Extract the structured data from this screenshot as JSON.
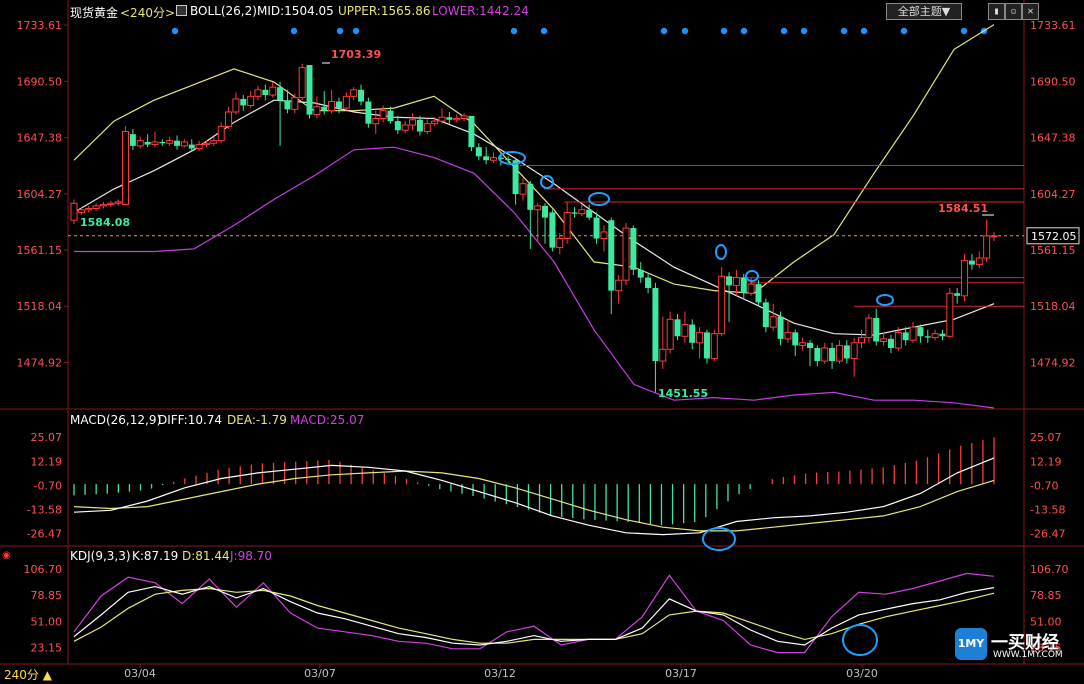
{
  "header": {
    "title": "现货黄金",
    "period": "<240分>",
    "boll_label": "BOLL(26,2)",
    "mid": "MID:1504.05",
    "upper": "UPPER:1565.86",
    "lower": "LOWER:1442.24",
    "theme_button": "全部主题▼"
  },
  "window_buttons": [
    "▮",
    "▫",
    "✕"
  ],
  "price_axis": {
    "ticks": [
      "1733.61",
      "1690.50",
      "1647.38",
      "1604.27",
      "1561.15",
      "1518.04",
      "1474.92"
    ],
    "current_price": "1572.05"
  },
  "annotations": {
    "high": "1703.39",
    "low": "1451.55",
    "left_price": "1584.08",
    "right_high": "1584.51"
  },
  "macd_panel": {
    "label": "MACD(26,12,9)",
    "diff": "DIFF:10.74",
    "dea": "DEA:-1.79",
    "macd": "MACD:25.07",
    "ticks": [
      "25.07",
      "12.19",
      "-0.70",
      "-13.58",
      "-26.47"
    ]
  },
  "kdj_panel": {
    "label": "KDJ(9,3,3)",
    "k": "K:87.19",
    "d": "D:81.44",
    "j": "J:98.70",
    "ticks": [
      "106.70",
      "78.85",
      "51.00",
      "23.15"
    ]
  },
  "footer": {
    "period_selector": "240分 ▲",
    "dates": [
      "03/04",
      "03/07",
      "03/12",
      "03/17",
      "03/20"
    ]
  },
  "watermark": {
    "logo_text": "1MY",
    "name": "一买财经",
    "url": "WWW.1MY.COM"
  },
  "colors": {
    "up": "#ff3b3b",
    "down": "#3ee8a0",
    "upper_band": "#e6e67a",
    "mid_band": "#e8e8e8",
    "lower_band": "#c040e0",
    "axis_text": "#ff5050",
    "dea": "#e6e67a",
    "diff": "#ffffff",
    "j_line": "#d040e0",
    "marker_dot": "#1e90ff",
    "circle": "#1ea0ff"
  },
  "chart_data": [
    {
      "type": "candlestick",
      "title": "现货黄金 <240分>",
      "ylim": [
        1451.55,
        1733.61
      ],
      "x": [
        "03/04",
        "03/07",
        "03/12",
        "03/17",
        "03/20"
      ],
      "candles": [
        {
          "o": 1584,
          "c": 1597,
          "h": 1600,
          "l": 1581
        },
        {
          "o": 1590,
          "c": 1592,
          "h": 1594,
          "l": 1588
        },
        {
          "o": 1592,
          "c": 1593,
          "h": 1595,
          "l": 1590
        },
        {
          "o": 1593,
          "c": 1595,
          "h": 1597,
          "l": 1591
        },
        {
          "o": 1595,
          "c": 1596,
          "h": 1598,
          "l": 1593
        },
        {
          "o": 1596,
          "c": 1597,
          "h": 1599,
          "l": 1594
        },
        {
          "o": 1597,
          "c": 1598,
          "h": 1600,
          "l": 1595
        },
        {
          "o": 1596,
          "c": 1652,
          "h": 1656,
          "l": 1596
        },
        {
          "o": 1650,
          "c": 1641,
          "h": 1654,
          "l": 1638
        },
        {
          "o": 1641,
          "c": 1645,
          "h": 1648,
          "l": 1639
        },
        {
          "o": 1644,
          "c": 1642,
          "h": 1650,
          "l": 1640
        },
        {
          "o": 1642,
          "c": 1644,
          "h": 1652,
          "l": 1640
        },
        {
          "o": 1644,
          "c": 1643,
          "h": 1646,
          "l": 1641
        },
        {
          "o": 1643,
          "c": 1645,
          "h": 1648,
          "l": 1641
        },
        {
          "o": 1645,
          "c": 1641,
          "h": 1649,
          "l": 1638
        },
        {
          "o": 1641,
          "c": 1644,
          "h": 1646,
          "l": 1640
        },
        {
          "o": 1642,
          "c": 1639,
          "h": 1646,
          "l": 1637
        },
        {
          "o": 1639,
          "c": 1642,
          "h": 1645,
          "l": 1637
        },
        {
          "o": 1642,
          "c": 1643,
          "h": 1645,
          "l": 1640
        },
        {
          "o": 1643,
          "c": 1645,
          "h": 1648,
          "l": 1641
        },
        {
          "o": 1645,
          "c": 1656,
          "h": 1659,
          "l": 1643
        },
        {
          "o": 1656,
          "c": 1667,
          "h": 1671,
          "l": 1654
        },
        {
          "o": 1667,
          "c": 1677,
          "h": 1682,
          "l": 1665
        },
        {
          "o": 1677,
          "c": 1672,
          "h": 1680,
          "l": 1668
        },
        {
          "o": 1672,
          "c": 1679,
          "h": 1683,
          "l": 1670
        },
        {
          "o": 1679,
          "c": 1684,
          "h": 1687,
          "l": 1676
        },
        {
          "o": 1684,
          "c": 1680,
          "h": 1688,
          "l": 1676
        },
        {
          "o": 1680,
          "c": 1686,
          "h": 1690,
          "l": 1678
        },
        {
          "o": 1686,
          "c": 1676,
          "h": 1690,
          "l": 1641
        },
        {
          "o": 1676,
          "c": 1669,
          "h": 1684,
          "l": 1666
        },
        {
          "o": 1669,
          "c": 1678,
          "h": 1681,
          "l": 1666
        },
        {
          "o": 1678,
          "c": 1701,
          "h": 1704,
          "l": 1676
        },
        {
          "o": 1703,
          "c": 1665,
          "h": 1703,
          "l": 1662
        },
        {
          "o": 1665,
          "c": 1671,
          "h": 1679,
          "l": 1662
        },
        {
          "o": 1671,
          "c": 1668,
          "h": 1683,
          "l": 1665
        },
        {
          "o": 1668,
          "c": 1675,
          "h": 1684,
          "l": 1666
        },
        {
          "o": 1675,
          "c": 1670,
          "h": 1678,
          "l": 1666
        },
        {
          "o": 1670,
          "c": 1679,
          "h": 1682,
          "l": 1668
        },
        {
          "o": 1679,
          "c": 1684,
          "h": 1686,
          "l": 1676
        },
        {
          "o": 1684,
          "c": 1675,
          "h": 1688,
          "l": 1672
        },
        {
          "o": 1675,
          "c": 1658,
          "h": 1678,
          "l": 1655
        },
        {
          "o": 1658,
          "c": 1662,
          "h": 1668,
          "l": 1650
        },
        {
          "o": 1662,
          "c": 1668,
          "h": 1672,
          "l": 1659
        },
        {
          "o": 1668,
          "c": 1660,
          "h": 1671,
          "l": 1658
        },
        {
          "o": 1660,
          "c": 1653,
          "h": 1664,
          "l": 1650
        },
        {
          "o": 1653,
          "c": 1657,
          "h": 1660,
          "l": 1651
        },
        {
          "o": 1657,
          "c": 1661,
          "h": 1666,
          "l": 1653
        },
        {
          "o": 1661,
          "c": 1652,
          "h": 1664,
          "l": 1649
        },
        {
          "o": 1652,
          "c": 1658,
          "h": 1662,
          "l": 1650
        },
        {
          "o": 1658,
          "c": 1660,
          "h": 1663,
          "l": 1656
        },
        {
          "o": 1660,
          "c": 1663,
          "h": 1670,
          "l": 1658
        },
        {
          "o": 1663,
          "c": 1661,
          "h": 1667,
          "l": 1658
        },
        {
          "o": 1661,
          "c": 1662,
          "h": 1665,
          "l": 1659
        },
        {
          "o": 1662,
          "c": 1664,
          "h": 1666,
          "l": 1660
        },
        {
          "o": 1664,
          "c": 1640,
          "h": 1664,
          "l": 1637
        },
        {
          "o": 1640,
          "c": 1633,
          "h": 1643,
          "l": 1630
        },
        {
          "o": 1633,
          "c": 1630,
          "h": 1640,
          "l": 1627
        },
        {
          "o": 1630,
          "c": 1632,
          "h": 1636,
          "l": 1628
        },
        {
          "o": 1632,
          "c": 1631,
          "h": 1636,
          "l": 1626
        },
        {
          "o": 1631,
          "c": 1630,
          "h": 1633,
          "l": 1627
        },
        {
          "o": 1630,
          "c": 1604,
          "h": 1632,
          "l": 1596
        },
        {
          "o": 1604,
          "c": 1612,
          "h": 1616,
          "l": 1599
        },
        {
          "o": 1612,
          "c": 1592,
          "h": 1614,
          "l": 1562
        },
        {
          "o": 1592,
          "c": 1595,
          "h": 1597,
          "l": 1568
        },
        {
          "o": 1595,
          "c": 1586,
          "h": 1597,
          "l": 1566
        },
        {
          "o": 1590,
          "c": 1563,
          "h": 1592,
          "l": 1560
        },
        {
          "o": 1563,
          "c": 1570,
          "h": 1574,
          "l": 1558
        },
        {
          "o": 1570,
          "c": 1590,
          "h": 1598,
          "l": 1566
        },
        {
          "o": 1590,
          "c": 1589,
          "h": 1594,
          "l": 1586
        },
        {
          "o": 1589,
          "c": 1592,
          "h": 1596,
          "l": 1587
        },
        {
          "o": 1592,
          "c": 1586,
          "h": 1596,
          "l": 1584
        },
        {
          "o": 1586,
          "c": 1570,
          "h": 1590,
          "l": 1566
        },
        {
          "o": 1570,
          "c": 1575,
          "h": 1580,
          "l": 1560
        },
        {
          "o": 1584,
          "c": 1530,
          "h": 1586,
          "l": 1512
        },
        {
          "o": 1530,
          "c": 1538,
          "h": 1542,
          "l": 1520
        },
        {
          "o": 1538,
          "c": 1578,
          "h": 1582,
          "l": 1534
        },
        {
          "o": 1578,
          "c": 1546,
          "h": 1580,
          "l": 1542
        },
        {
          "o": 1546,
          "c": 1540,
          "h": 1552,
          "l": 1536
        },
        {
          "o": 1540,
          "c": 1532,
          "h": 1544,
          "l": 1528
        },
        {
          "o": 1532,
          "c": 1476,
          "h": 1536,
          "l": 1452
        },
        {
          "o": 1476,
          "c": 1485,
          "h": 1510,
          "l": 1470
        },
        {
          "o": 1485,
          "c": 1508,
          "h": 1514,
          "l": 1482
        },
        {
          "o": 1508,
          "c": 1495,
          "h": 1512,
          "l": 1492
        },
        {
          "o": 1495,
          "c": 1504,
          "h": 1514,
          "l": 1490
        },
        {
          "o": 1504,
          "c": 1490,
          "h": 1508,
          "l": 1485
        },
        {
          "o": 1490,
          "c": 1498,
          "h": 1502,
          "l": 1478
        },
        {
          "o": 1498,
          "c": 1478,
          "h": 1500,
          "l": 1474
        },
        {
          "o": 1478,
          "c": 1497,
          "h": 1500,
          "l": 1476
        },
        {
          "o": 1497,
          "c": 1541,
          "h": 1548,
          "l": 1495
        },
        {
          "o": 1541,
          "c": 1534,
          "h": 1544,
          "l": 1506
        },
        {
          "o": 1534,
          "c": 1540,
          "h": 1546,
          "l": 1526
        },
        {
          "o": 1540,
          "c": 1528,
          "h": 1543,
          "l": 1523
        },
        {
          "o": 1528,
          "c": 1535,
          "h": 1540,
          "l": 1526
        },
        {
          "o": 1535,
          "c": 1521,
          "h": 1538,
          "l": 1519
        },
        {
          "o": 1521,
          "c": 1502,
          "h": 1524,
          "l": 1498
        },
        {
          "o": 1502,
          "c": 1510,
          "h": 1520,
          "l": 1499
        },
        {
          "o": 1510,
          "c": 1493,
          "h": 1514,
          "l": 1488
        },
        {
          "o": 1493,
          "c": 1498,
          "h": 1508,
          "l": 1490
        },
        {
          "o": 1498,
          "c": 1488,
          "h": 1500,
          "l": 1480
        },
        {
          "o": 1488,
          "c": 1490,
          "h": 1494,
          "l": 1484
        },
        {
          "o": 1490,
          "c": 1486,
          "h": 1492,
          "l": 1472
        },
        {
          "o": 1486,
          "c": 1476,
          "h": 1488,
          "l": 1472
        },
        {
          "o": 1476,
          "c": 1486,
          "h": 1490,
          "l": 1474
        },
        {
          "o": 1486,
          "c": 1476,
          "h": 1490,
          "l": 1470
        },
        {
          "o": 1476,
          "c": 1488,
          "h": 1492,
          "l": 1474
        },
        {
          "o": 1488,
          "c": 1478,
          "h": 1492,
          "l": 1474
        },
        {
          "o": 1478,
          "c": 1490,
          "h": 1494,
          "l": 1464
        },
        {
          "o": 1490,
          "c": 1494,
          "h": 1500,
          "l": 1486
        },
        {
          "o": 1494,
          "c": 1509,
          "h": 1512,
          "l": 1490
        },
        {
          "o": 1509,
          "c": 1491,
          "h": 1516,
          "l": 1488
        },
        {
          "o": 1491,
          "c": 1493,
          "h": 1498,
          "l": 1488
        },
        {
          "o": 1493,
          "c": 1486,
          "h": 1496,
          "l": 1482
        },
        {
          "o": 1486,
          "c": 1498,
          "h": 1502,
          "l": 1484
        },
        {
          "o": 1498,
          "c": 1492,
          "h": 1502,
          "l": 1488
        },
        {
          "o": 1492,
          "c": 1502,
          "h": 1506,
          "l": 1490
        },
        {
          "o": 1502,
          "c": 1495,
          "h": 1504,
          "l": 1490
        },
        {
          "o": 1495,
          "c": 1494,
          "h": 1500,
          "l": 1490
        },
        {
          "o": 1494,
          "c": 1497,
          "h": 1500,
          "l": 1492
        },
        {
          "o": 1497,
          "c": 1495,
          "h": 1500,
          "l": 1492
        },
        {
          "o": 1495,
          "c": 1528,
          "h": 1532,
          "l": 1494
        },
        {
          "o": 1528,
          "c": 1526,
          "h": 1532,
          "l": 1520
        },
        {
          "o": 1526,
          "c": 1553,
          "h": 1558,
          "l": 1522
        },
        {
          "o": 1553,
          "c": 1550,
          "h": 1558,
          "l": 1546
        },
        {
          "o": 1550,
          "c": 1555,
          "h": 1560,
          "l": 1547
        },
        {
          "o": 1555,
          "c": 1572,
          "h": 1584.51,
          "l": 1552
        },
        {
          "o": 1572,
          "c": 1572,
          "h": 1575,
          "l": 1568
        }
      ],
      "boll_upper": [
        1630,
        1660,
        1676,
        1688,
        1700,
        1690,
        1668,
        1668,
        1670,
        1679,
        1658,
        1625,
        1592,
        1552,
        1548,
        1535,
        1530,
        1528,
        1552,
        1573,
        1620,
        1665,
        1715,
        1734
      ],
      "boll_mid": [
        1590,
        1608,
        1622,
        1638,
        1659,
        1676,
        1674,
        1667,
        1663,
        1662,
        1650,
        1632,
        1612,
        1590,
        1568,
        1548,
        1534,
        1520,
        1505,
        1497,
        1496,
        1502,
        1508,
        1520
      ],
      "boll_lower": [
        1560,
        1560,
        1560,
        1562,
        1580,
        1600,
        1618,
        1638,
        1640,
        1632,
        1620,
        1590,
        1552,
        1500,
        1458,
        1446,
        1448,
        1446,
        1450,
        1452,
        1446,
        1446,
        1444,
        1440
      ]
    },
    {
      "type": "bar",
      "title": "MACD(26,12,9)",
      "ylim": [
        -26.47,
        25.07
      ],
      "series": [
        {
          "name": "DIFF",
          "values": [
            -15,
            -14,
            -9,
            -2,
            3,
            6,
            8,
            10,
            9,
            7,
            2,
            -4,
            -10,
            -17,
            -22,
            -26,
            -27,
            -26,
            -20,
            -18,
            -17,
            -15,
            -12,
            -5,
            6,
            14
          ]
        },
        {
          "name": "DEA",
          "values": [
            -12,
            -13,
            -12,
            -8,
            -4,
            0,
            3,
            5,
            6,
            7,
            6,
            3,
            -2,
            -8,
            -14,
            -19,
            -23,
            -25,
            -25,
            -23,
            -21,
            -19,
            -17,
            -12,
            -4,
            2
          ]
        },
        {
          "name": "MACD",
          "values": [
            -6,
            -5,
            -3,
            3,
            8,
            11,
            12,
            13,
            8,
            3,
            -3,
            -7,
            -12,
            -17,
            -19,
            -20,
            -22,
            -20,
            -6,
            3,
            6,
            7,
            9,
            13,
            20,
            25
          ]
        }
      ]
    },
    {
      "type": "line",
      "title": "KDJ(9,3,3)",
      "ylim": [
        23.15,
        106.7
      ],
      "series": [
        {
          "name": "K",
          "values": [
            35,
            58,
            82,
            88,
            80,
            88,
            76,
            86,
            72,
            60,
            54,
            46,
            38,
            34,
            28,
            26,
            30,
            36,
            30,
            32,
            32,
            44,
            75,
            62,
            58,
            42,
            30,
            26,
            44,
            58,
            64,
            70,
            74,
            82,
            87
          ]
        },
        {
          "name": "D",
          "values": [
            30,
            45,
            65,
            80,
            84,
            86,
            82,
            84,
            78,
            68,
            60,
            52,
            44,
            38,
            32,
            28,
            28,
            32,
            32,
            32,
            32,
            38,
            58,
            62,
            60,
            50,
            40,
            32,
            38,
            48,
            56,
            62,
            68,
            74,
            81
          ]
        },
        {
          "name": "J",
          "values": [
            40,
            78,
            98,
            92,
            70,
            96,
            66,
            92,
            60,
            44,
            40,
            36,
            30,
            28,
            22,
            22,
            40,
            46,
            26,
            32,
            32,
            56,
            100,
            62,
            52,
            26,
            18,
            18,
            56,
            82,
            80,
            86,
            94,
            102,
            99
          ]
        }
      ]
    }
  ]
}
